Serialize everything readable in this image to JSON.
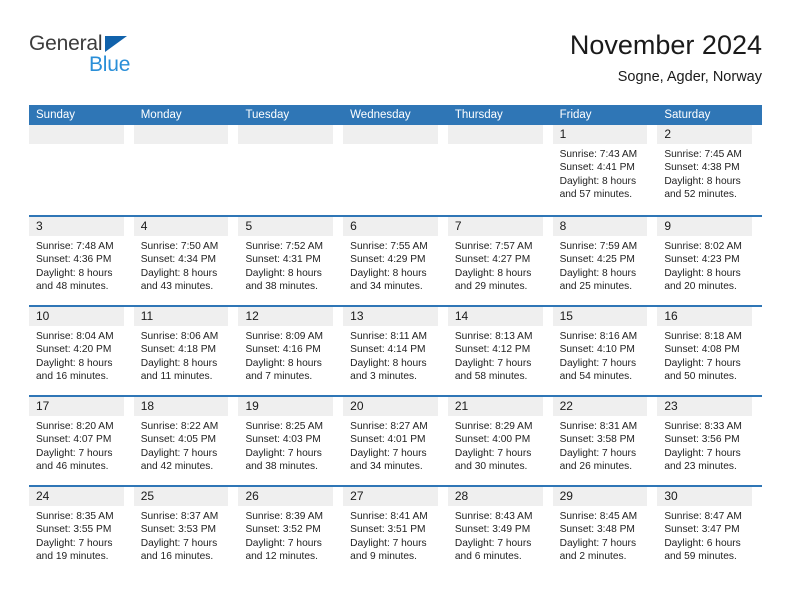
{
  "brand": {
    "name_top": "General",
    "name_bottom": "Blue"
  },
  "header": {
    "title": "November 2024",
    "location": "Sogne, Agder, Norway"
  },
  "colors": {
    "header_blue": "#2f76b6",
    "daynum_gray": "#efefef",
    "logo_blue": "#2a8fd8",
    "logo_triangle": "#1162ab",
    "text": "#1a1a1a"
  },
  "weekday_headers": [
    "Sunday",
    "Monday",
    "Tuesday",
    "Wednesday",
    "Thursday",
    "Friday",
    "Saturday"
  ],
  "labels": {
    "sunrise_prefix": "Sunrise: ",
    "sunset_prefix": "Sunset: ",
    "daylight_prefix": "Daylight: "
  },
  "weeks": [
    [
      {
        "day": "",
        "empty": true
      },
      {
        "day": "",
        "empty": true
      },
      {
        "day": "",
        "empty": true
      },
      {
        "day": "",
        "empty": true
      },
      {
        "day": "",
        "empty": true
      },
      {
        "day": "1",
        "sunrise": "Sunrise: 7:43 AM",
        "sunset": "Sunset: 4:41 PM",
        "daylight_1": "Daylight: 8 hours",
        "daylight_2": "and 57 minutes."
      },
      {
        "day": "2",
        "sunrise": "Sunrise: 7:45 AM",
        "sunset": "Sunset: 4:38 PM",
        "daylight_1": "Daylight: 8 hours",
        "daylight_2": "and 52 minutes."
      }
    ],
    [
      {
        "day": "3",
        "sunrise": "Sunrise: 7:48 AM",
        "sunset": "Sunset: 4:36 PM",
        "daylight_1": "Daylight: 8 hours",
        "daylight_2": "and 48 minutes."
      },
      {
        "day": "4",
        "sunrise": "Sunrise: 7:50 AM",
        "sunset": "Sunset: 4:34 PM",
        "daylight_1": "Daylight: 8 hours",
        "daylight_2": "and 43 minutes."
      },
      {
        "day": "5",
        "sunrise": "Sunrise: 7:52 AM",
        "sunset": "Sunset: 4:31 PM",
        "daylight_1": "Daylight: 8 hours",
        "daylight_2": "and 38 minutes."
      },
      {
        "day": "6",
        "sunrise": "Sunrise: 7:55 AM",
        "sunset": "Sunset: 4:29 PM",
        "daylight_1": "Daylight: 8 hours",
        "daylight_2": "and 34 minutes."
      },
      {
        "day": "7",
        "sunrise": "Sunrise: 7:57 AM",
        "sunset": "Sunset: 4:27 PM",
        "daylight_1": "Daylight: 8 hours",
        "daylight_2": "and 29 minutes."
      },
      {
        "day": "8",
        "sunrise": "Sunrise: 7:59 AM",
        "sunset": "Sunset: 4:25 PM",
        "daylight_1": "Daylight: 8 hours",
        "daylight_2": "and 25 minutes."
      },
      {
        "day": "9",
        "sunrise": "Sunrise: 8:02 AM",
        "sunset": "Sunset: 4:23 PM",
        "daylight_1": "Daylight: 8 hours",
        "daylight_2": "and 20 minutes."
      }
    ],
    [
      {
        "day": "10",
        "sunrise": "Sunrise: 8:04 AM",
        "sunset": "Sunset: 4:20 PM",
        "daylight_1": "Daylight: 8 hours",
        "daylight_2": "and 16 minutes."
      },
      {
        "day": "11",
        "sunrise": "Sunrise: 8:06 AM",
        "sunset": "Sunset: 4:18 PM",
        "daylight_1": "Daylight: 8 hours",
        "daylight_2": "and 11 minutes."
      },
      {
        "day": "12",
        "sunrise": "Sunrise: 8:09 AM",
        "sunset": "Sunset: 4:16 PM",
        "daylight_1": "Daylight: 8 hours",
        "daylight_2": "and 7 minutes."
      },
      {
        "day": "13",
        "sunrise": "Sunrise: 8:11 AM",
        "sunset": "Sunset: 4:14 PM",
        "daylight_1": "Daylight: 8 hours",
        "daylight_2": "and 3 minutes."
      },
      {
        "day": "14",
        "sunrise": "Sunrise: 8:13 AM",
        "sunset": "Sunset: 4:12 PM",
        "daylight_1": "Daylight: 7 hours",
        "daylight_2": "and 58 minutes."
      },
      {
        "day": "15",
        "sunrise": "Sunrise: 8:16 AM",
        "sunset": "Sunset: 4:10 PM",
        "daylight_1": "Daylight: 7 hours",
        "daylight_2": "and 54 minutes."
      },
      {
        "day": "16",
        "sunrise": "Sunrise: 8:18 AM",
        "sunset": "Sunset: 4:08 PM",
        "daylight_1": "Daylight: 7 hours",
        "daylight_2": "and 50 minutes."
      }
    ],
    [
      {
        "day": "17",
        "sunrise": "Sunrise: 8:20 AM",
        "sunset": "Sunset: 4:07 PM",
        "daylight_1": "Daylight: 7 hours",
        "daylight_2": "and 46 minutes."
      },
      {
        "day": "18",
        "sunrise": "Sunrise: 8:22 AM",
        "sunset": "Sunset: 4:05 PM",
        "daylight_1": "Daylight: 7 hours",
        "daylight_2": "and 42 minutes."
      },
      {
        "day": "19",
        "sunrise": "Sunrise: 8:25 AM",
        "sunset": "Sunset: 4:03 PM",
        "daylight_1": "Daylight: 7 hours",
        "daylight_2": "and 38 minutes."
      },
      {
        "day": "20",
        "sunrise": "Sunrise: 8:27 AM",
        "sunset": "Sunset: 4:01 PM",
        "daylight_1": "Daylight: 7 hours",
        "daylight_2": "and 34 minutes."
      },
      {
        "day": "21",
        "sunrise": "Sunrise: 8:29 AM",
        "sunset": "Sunset: 4:00 PM",
        "daylight_1": "Daylight: 7 hours",
        "daylight_2": "and 30 minutes."
      },
      {
        "day": "22",
        "sunrise": "Sunrise: 8:31 AM",
        "sunset": "Sunset: 3:58 PM",
        "daylight_1": "Daylight: 7 hours",
        "daylight_2": "and 26 minutes."
      },
      {
        "day": "23",
        "sunrise": "Sunrise: 8:33 AM",
        "sunset": "Sunset: 3:56 PM",
        "daylight_1": "Daylight: 7 hours",
        "daylight_2": "and 23 minutes."
      }
    ],
    [
      {
        "day": "24",
        "sunrise": "Sunrise: 8:35 AM",
        "sunset": "Sunset: 3:55 PM",
        "daylight_1": "Daylight: 7 hours",
        "daylight_2": "and 19 minutes."
      },
      {
        "day": "25",
        "sunrise": "Sunrise: 8:37 AM",
        "sunset": "Sunset: 3:53 PM",
        "daylight_1": "Daylight: 7 hours",
        "daylight_2": "and 16 minutes."
      },
      {
        "day": "26",
        "sunrise": "Sunrise: 8:39 AM",
        "sunset": "Sunset: 3:52 PM",
        "daylight_1": "Daylight: 7 hours",
        "daylight_2": "and 12 minutes."
      },
      {
        "day": "27",
        "sunrise": "Sunrise: 8:41 AM",
        "sunset": "Sunset: 3:51 PM",
        "daylight_1": "Daylight: 7 hours",
        "daylight_2": "and 9 minutes."
      },
      {
        "day": "28",
        "sunrise": "Sunrise: 8:43 AM",
        "sunset": "Sunset: 3:49 PM",
        "daylight_1": "Daylight: 7 hours",
        "daylight_2": "and 6 minutes."
      },
      {
        "day": "29",
        "sunrise": "Sunrise: 8:45 AM",
        "sunset": "Sunset: 3:48 PM",
        "daylight_1": "Daylight: 7 hours",
        "daylight_2": "and 2 minutes."
      },
      {
        "day": "30",
        "sunrise": "Sunrise: 8:47 AM",
        "sunset": "Sunset: 3:47 PM",
        "daylight_1": "Daylight: 6 hours",
        "daylight_2": "and 59 minutes."
      }
    ]
  ]
}
